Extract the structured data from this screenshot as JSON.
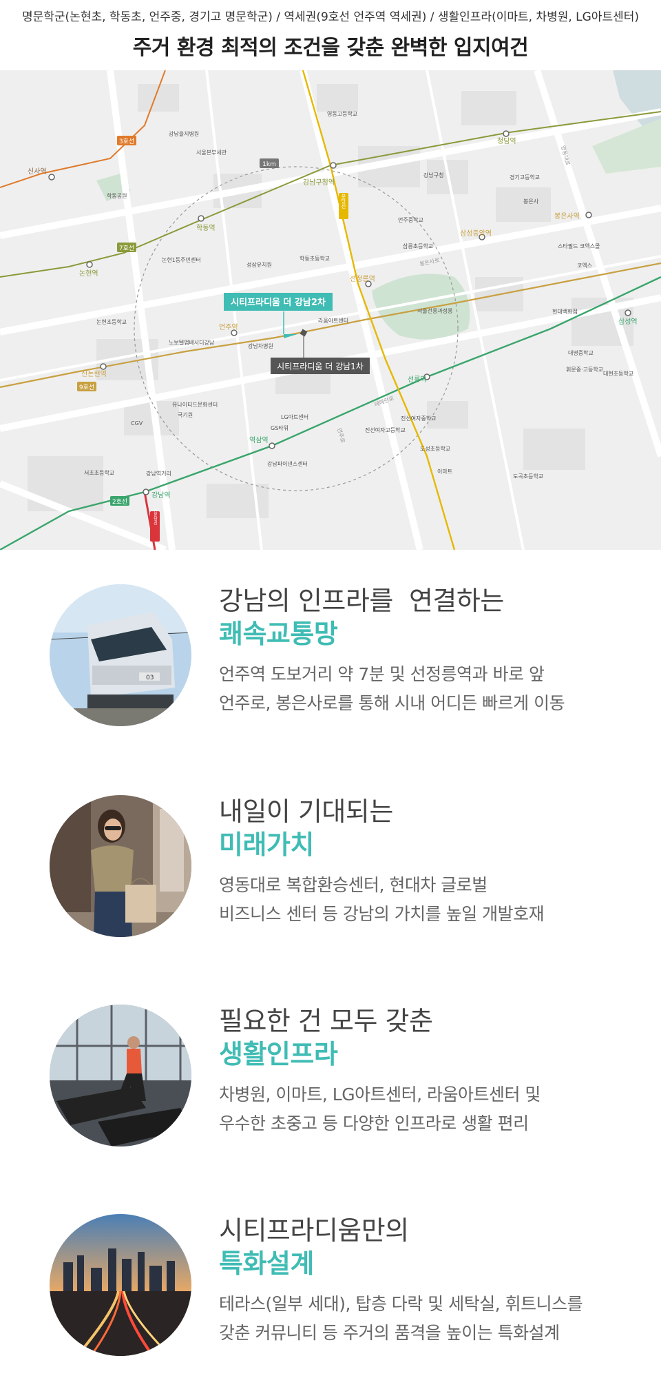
{
  "header": {
    "subtitle": "명문학군(논현초, 학동초, 언주중, 경기고 명문학군) / 역세권(9호선 언주역 역세권) / 생활인프라(이마트, 차병원, LG아트센터)",
    "title": "주거 환경 최적의 조건을 갖춘 완벽한 입지여건"
  },
  "map": {
    "scale_label": "1km",
    "site2_label": "시티프라디움 더 강남2차",
    "site1_label": "시티프라디움 더 강남1차",
    "line_labels": [
      "3호선",
      "7호선",
      "9호선",
      "2호선",
      "분당선",
      "신분당선"
    ],
    "stations": [
      "신사역",
      "논현역",
      "학동역",
      "강남구청역",
      "청담역",
      "봉은사역",
      "삼성중앙역",
      "선정릉역",
      "삼성역",
      "언주역",
      "신논현역",
      "선릉역",
      "역삼역",
      "강남역"
    ],
    "places": [
      "영동고등학교",
      "강남을지병원",
      "서울본부세관",
      "강남구청",
      "경기고등학교",
      "봉은사",
      "학동공원",
      "언주중학교",
      "삼릉초등학교",
      "스타필드 코엑스몰",
      "코엑스",
      "논현1동주민센터",
      "성삼유치원",
      "학동초등학교",
      "서울선릉과정릉",
      "현대백화점",
      "논현초등학교",
      "라움아트센터",
      "강남차병원",
      "대명중학교",
      "휘문중·고등학교",
      "노보텔앰배서더강남",
      "대현초등학교",
      "유나이티드문화센터",
      "국기원",
      "LG아트센터",
      "GS타워",
      "진선여자중학교",
      "진선여자고등학교",
      "CGV",
      "도성초등학교",
      "서초초등학교",
      "강남역거리",
      "강남파이낸스센터",
      "이마트",
      "도곡초등학교"
    ],
    "road_labels": [
      "봉은사로",
      "테헤란로",
      "언주로",
      "영동대로"
    ]
  },
  "features": [
    {
      "title": "강남의 인프라를  연결하는",
      "highlight": "쾌속교통망",
      "desc1": "언주역 도보거리 약 7분 및 선정릉역과 바로 앞",
      "desc2": "언주로, 봉은사로를 통해 시내 어디든 빠르게 이동"
    },
    {
      "title": "내일이 기대되는",
      "highlight": "미래가치",
      "desc1": "영동대로 복합환승센터, 현대차 글로벌",
      "desc2": "비즈니스 센터 등 강남의 가치를 높일 개발호재"
    },
    {
      "title": "필요한 건 모두 갖춘",
      "highlight": "생활인프라",
      "desc1": "차병원, 이마트, LG아트센터, 라움아트센터 및",
      "desc2": "우수한 초중고 등 다양한 인프라로 생활 편리"
    },
    {
      "title": "시티프라디움만의",
      "highlight": "특화설계",
      "desc1": "테라스(일부 세대), 탑층 다락 및 세탁실, 휘트니스를",
      "desc2": "갖춘 커뮤니티 등 주거의 품격을 높이는 특화설계"
    }
  ],
  "colors": {
    "accent": "#3fbcb4",
    "line2": "#3aa56c",
    "line7": "#8a9a3a",
    "line9": "#c8a040",
    "line3": "#e07a2a",
    "bundang": "#e6b800",
    "shinbundang": "#d9353b"
  }
}
